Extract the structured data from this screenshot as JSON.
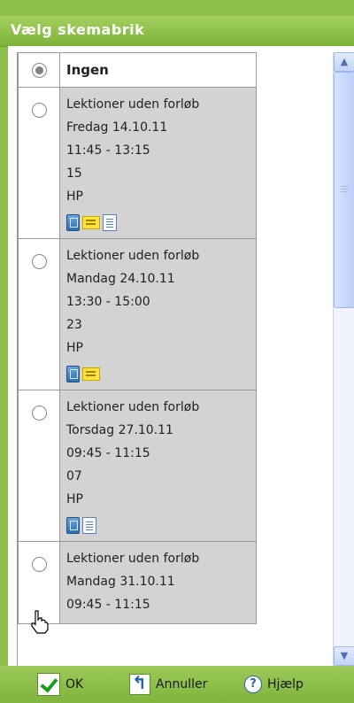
{
  "dialog": {
    "title": "Vælg skemabrik"
  },
  "none_option": {
    "label": "Ingen",
    "selected": true
  },
  "entries": [
    {
      "course": "Lektioner uden forløb",
      "date": "Fredag 14.10.11",
      "time": "11:45 - 13:15",
      "room": "15",
      "teacher": "HP",
      "icons": [
        "book-icon",
        "note-icon",
        "document-icon"
      ]
    },
    {
      "course": "Lektioner uden forløb",
      "date": "Mandag 24.10.11",
      "time": "13:30 - 15:00",
      "room": "23",
      "teacher": "HP",
      "icons": [
        "book-icon",
        "note-icon"
      ]
    },
    {
      "course": "Lektioner uden forløb",
      "date": "Torsdag 27.10.11",
      "time": "09:45 - 11:15",
      "room": "07",
      "teacher": "HP",
      "icons": [
        "book-icon",
        "document-icon"
      ]
    },
    {
      "course": "Lektioner uden forløb",
      "date": "Mandag 31.10.11",
      "time": "09:45 - 11:15",
      "room": "",
      "teacher": "",
      "icons": []
    }
  ],
  "footer": {
    "ok_label": "OK",
    "cancel_label": "Annuller",
    "help_label": "Hjælp"
  },
  "colors": {
    "accent_green": "#8cbf4a",
    "row_gray": "#d3d3d3",
    "scroll_blue": "#c3d3f5"
  }
}
